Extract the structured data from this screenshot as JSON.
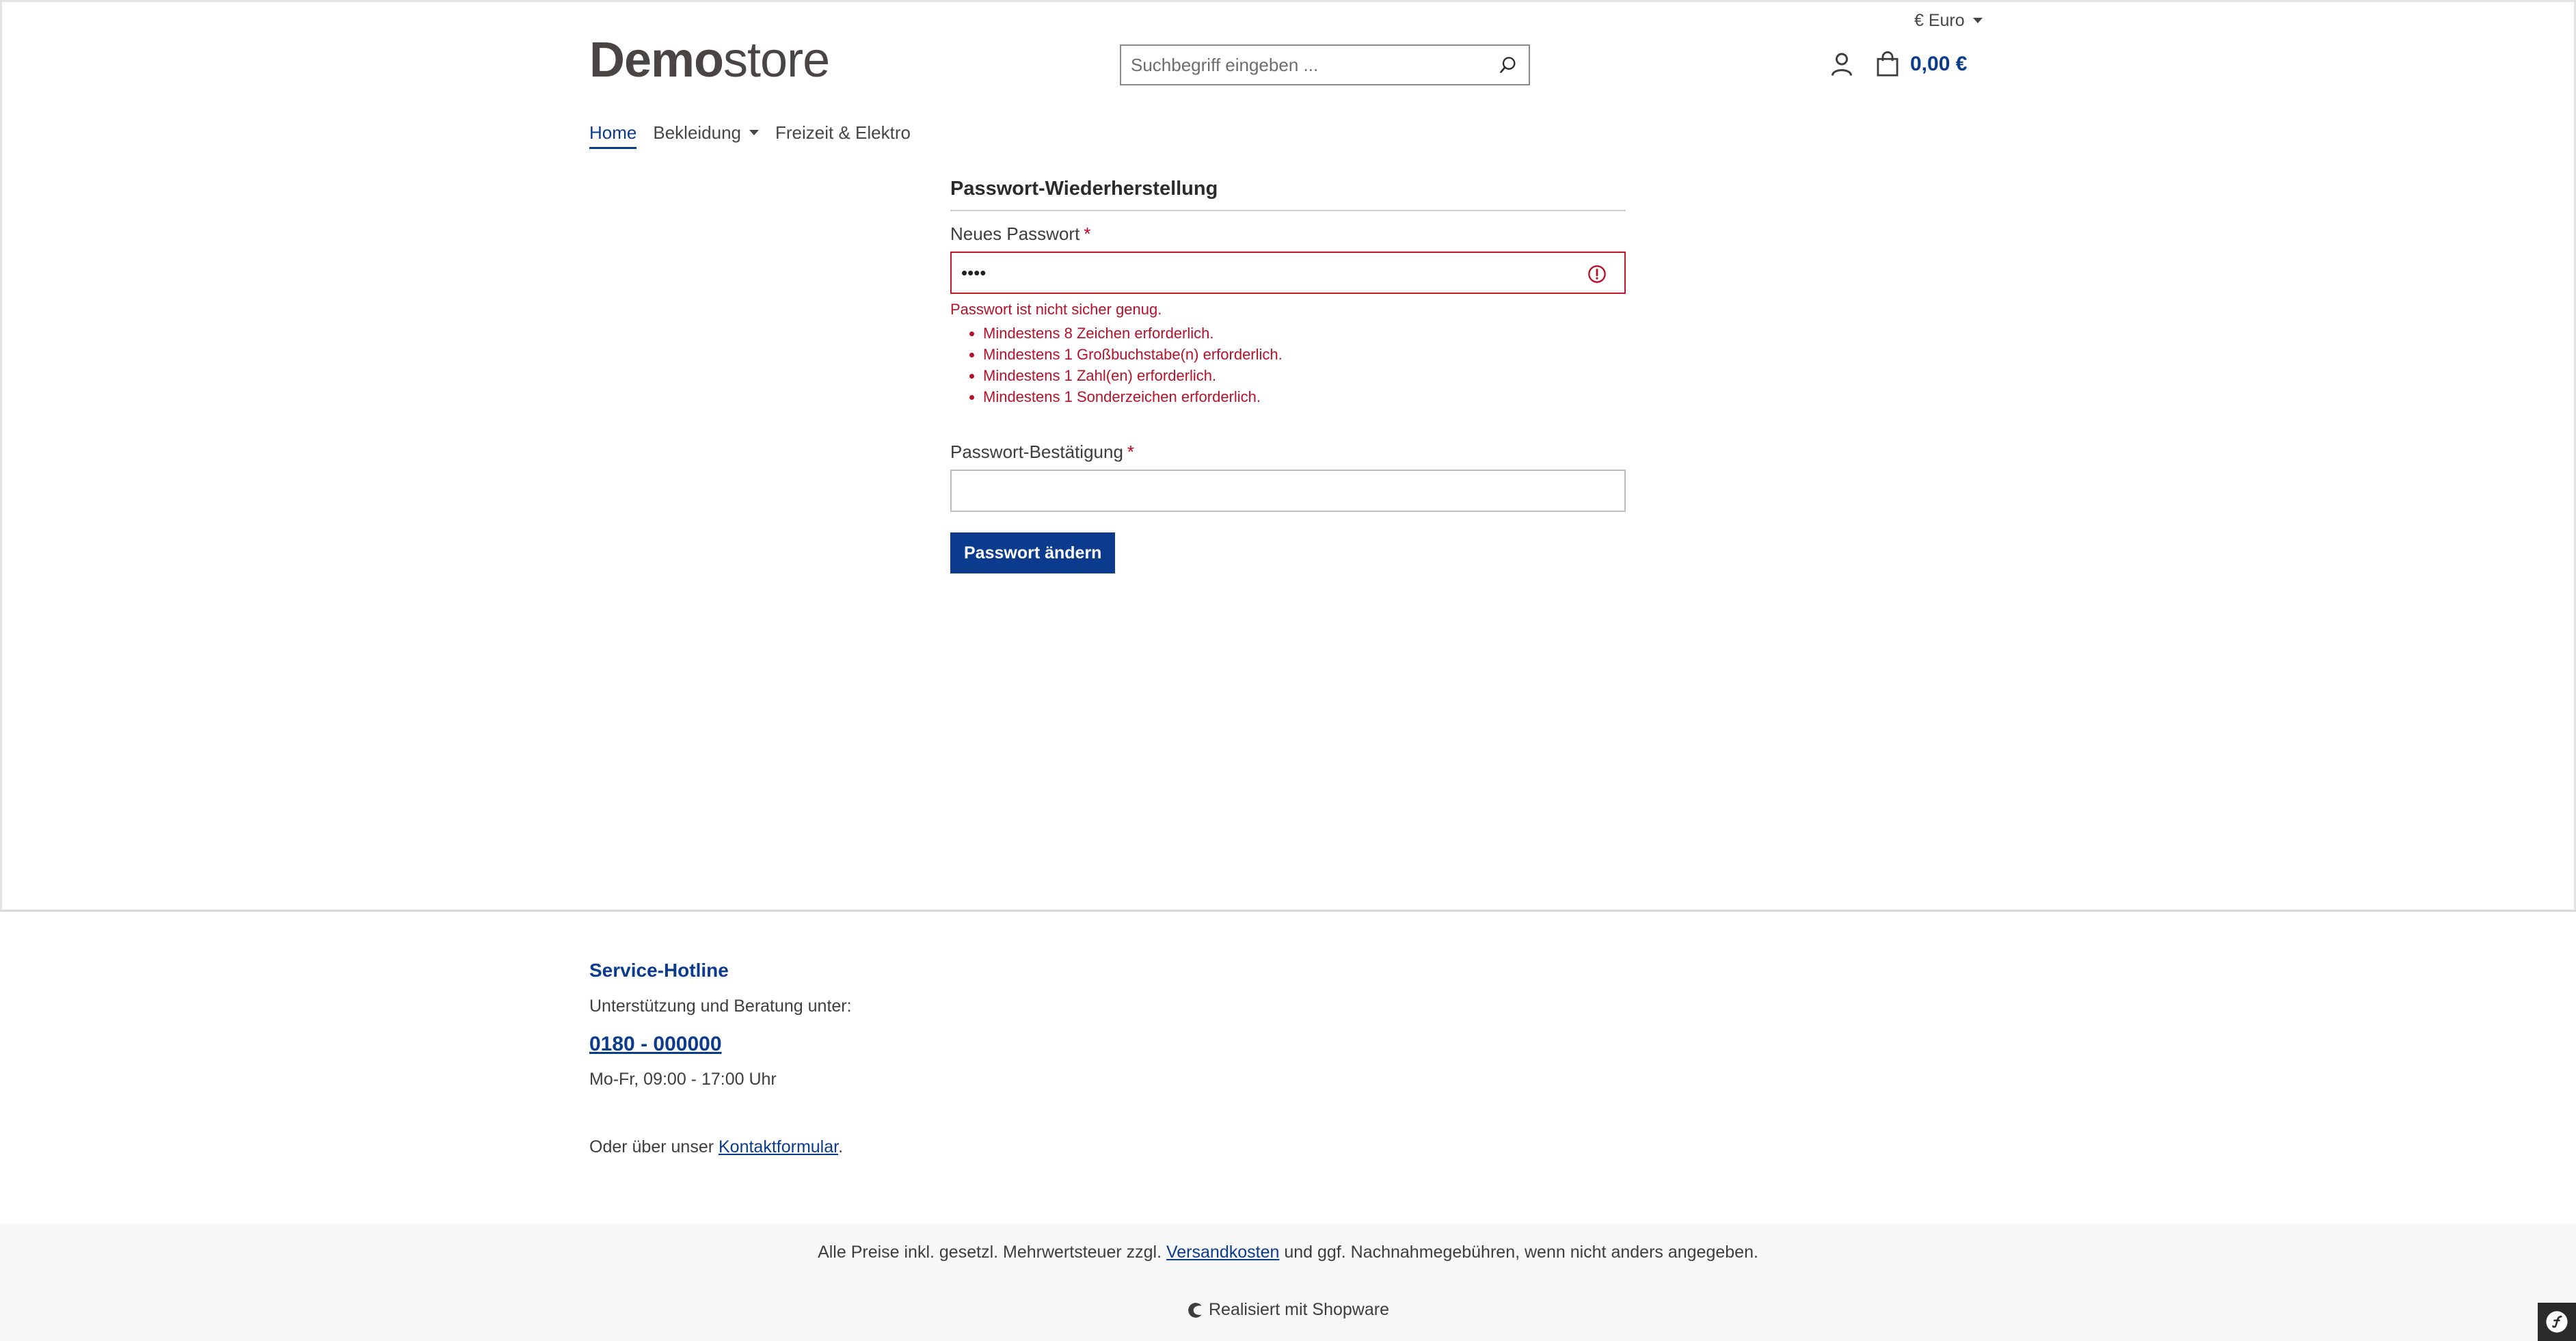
{
  "header": {
    "currency_label": "€ Euro",
    "logo_bold": "Demo",
    "logo_light": "store",
    "search_placeholder": "Suchbegriff eingeben ...",
    "cart_total": "0,00 €"
  },
  "nav": {
    "items": [
      {
        "label": "Home",
        "active": true
      },
      {
        "label": "Bekleidung",
        "has_dropdown": true
      },
      {
        "label": "Freizeit & Elektro"
      }
    ]
  },
  "form": {
    "title": "Passwort-Wiederherstellung",
    "new_password": {
      "label": "Neues Passwort",
      "required_mark": "*",
      "value": "••••"
    },
    "error_main": "Passwort ist nicht sicher genug.",
    "errors": [
      "Mindestens 8 Zeichen erforderlich.",
      "Mindestens 1 Großbuchstabe(n) erforderlich.",
      "Mindestens 1 Zahl(en) erforderlich.",
      "Mindestens 1 Sonderzeichen erforderlich."
    ],
    "confirm_password": {
      "label": "Passwort-Bestätigung",
      "required_mark": "*",
      "value": ""
    },
    "submit_label": "Passwort ändern"
  },
  "footer": {
    "heading": "Service-Hotline",
    "support_text": "Unterstützung und Beratung unter:",
    "phone": "0180 - 000000",
    "hours": "Mo-Fr, 09:00 - 17:00 Uhr",
    "contact_prefix": "Oder über unser ",
    "contact_link": "Kontaktformular",
    "contact_suffix": ".",
    "vat_prefix": "Alle Preise inkl. gesetzl. Mehrwertsteuer zzgl. ",
    "vat_link": "Versandkosten",
    "vat_suffix": " und ggf. Nachnahmegebühren, wenn nicht anders angegeben.",
    "powered_by": "Realisiert mit Shopware"
  },
  "colors": {
    "brand": "#0b3b8c",
    "error": "#b3122a",
    "text": "#4a4545"
  }
}
